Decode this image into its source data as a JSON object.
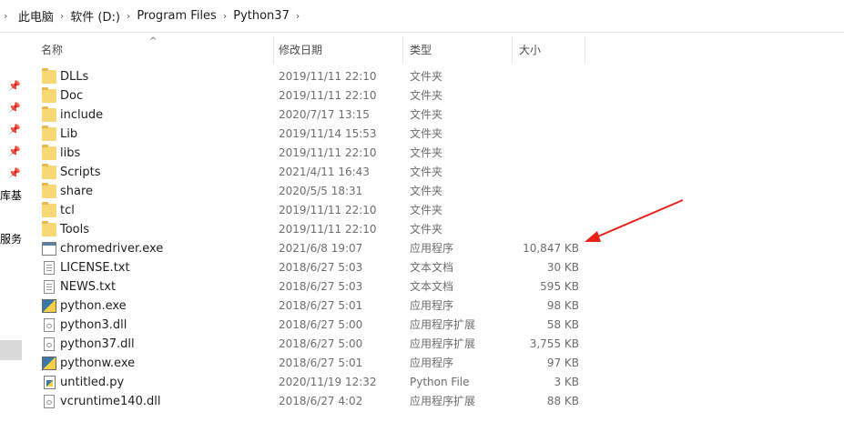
{
  "breadcrumb": {
    "items": [
      "此电脑",
      "软件 (D:)",
      "Program Files",
      "Python37"
    ]
  },
  "sidebar": {
    "words": [
      "库基",
      "服务"
    ]
  },
  "columns": {
    "name": "名称",
    "date": "修改日期",
    "type": "类型",
    "size": "大小"
  },
  "files": [
    {
      "name": "DLLs",
      "date": "2019/11/11 22:10",
      "type": "文件夹",
      "size": "",
      "icon": "folder-icon"
    },
    {
      "name": "Doc",
      "date": "2019/11/11 22:10",
      "type": "文件夹",
      "size": "",
      "icon": "folder-icon"
    },
    {
      "name": "include",
      "date": "2020/7/17 13:15",
      "type": "文件夹",
      "size": "",
      "icon": "folder-icon"
    },
    {
      "name": "Lib",
      "date": "2019/11/14 15:53",
      "type": "文件夹",
      "size": "",
      "icon": "folder-icon"
    },
    {
      "name": "libs",
      "date": "2019/11/11 22:10",
      "type": "文件夹",
      "size": "",
      "icon": "folder-icon"
    },
    {
      "name": "Scripts",
      "date": "2021/4/11 16:43",
      "type": "文件夹",
      "size": "",
      "icon": "folder-icon"
    },
    {
      "name": "share",
      "date": "2020/5/5 18:31",
      "type": "文件夹",
      "size": "",
      "icon": "folder-icon"
    },
    {
      "name": "tcl",
      "date": "2019/11/11 22:10",
      "type": "文件夹",
      "size": "",
      "icon": "folder-icon"
    },
    {
      "name": "Tools",
      "date": "2019/11/11 22:10",
      "type": "文件夹",
      "size": "",
      "icon": "folder-icon"
    },
    {
      "name": "chromedriver.exe",
      "date": "2021/6/8 19:07",
      "type": "应用程序",
      "size": "10,847 KB",
      "icon": "exe-icon"
    },
    {
      "name": "LICENSE.txt",
      "date": "2018/6/27 5:03",
      "type": "文本文档",
      "size": "30 KB",
      "icon": "text-file-icon"
    },
    {
      "name": "NEWS.txt",
      "date": "2018/6/27 5:03",
      "type": "文本文档",
      "size": "595 KB",
      "icon": "text-file-icon"
    },
    {
      "name": "python.exe",
      "date": "2018/6/27 5:01",
      "type": "应用程序",
      "size": "98 KB",
      "icon": "python-exe-icon"
    },
    {
      "name": "python3.dll",
      "date": "2018/6/27 5:00",
      "type": "应用程序扩展",
      "size": "58 KB",
      "icon": "dll-icon"
    },
    {
      "name": "python37.dll",
      "date": "2018/6/27 5:00",
      "type": "应用程序扩展",
      "size": "3,755 KB",
      "icon": "dll-icon"
    },
    {
      "name": "pythonw.exe",
      "date": "2018/6/27 5:01",
      "type": "应用程序",
      "size": "97 KB",
      "icon": "python-exe-icon"
    },
    {
      "name": "untitled.py",
      "date": "2020/11/19 12:32",
      "type": "Python File",
      "size": "3 KB",
      "icon": "python-file-icon"
    },
    {
      "name": "vcruntime140.dll",
      "date": "2018/6/27 4:02",
      "type": "应用程序扩展",
      "size": "88 KB",
      "icon": "dll-icon"
    }
  ],
  "annotation": {
    "arrow_color": "#e8211b"
  }
}
